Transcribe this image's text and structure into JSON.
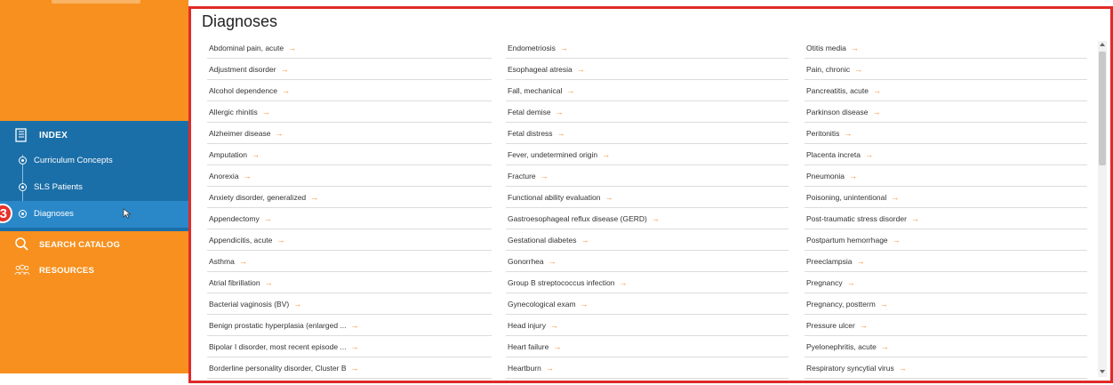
{
  "sidebar": {
    "index_label": "INDEX",
    "index_items": [
      {
        "label": "Curriculum Concepts"
      },
      {
        "label": "SLS Patients"
      },
      {
        "label": "Diagnoses"
      }
    ],
    "step_badge": "3",
    "nav": [
      {
        "label": "SEARCH CATALOG",
        "icon": "search-icon"
      },
      {
        "label": "RESOURCES",
        "icon": "people-icon"
      }
    ]
  },
  "main": {
    "title": "Diagnoses",
    "arrow_glyph": "→",
    "columns": [
      [
        "Abdominal pain, acute",
        "Adjustment disorder",
        "Alcohol dependence",
        "Allergic rhinitis",
        "Alzheimer disease",
        "Amputation",
        "Anorexia",
        "Anxiety disorder, generalized",
        "Appendectomy",
        "Appendicitis, acute",
        "Asthma",
        "Atrial fibrillation",
        "Bacterial vaginosis (BV)",
        "Benign prostatic hyperplasia (enlarged ...",
        "Bipolar I disorder, most recent episode ...",
        "Borderline personality disorder, Cluster B"
      ],
      [
        "Endometriosis",
        "Esophageal atresia",
        "Fall, mechanical",
        "Fetal demise",
        "Fetal distress",
        "Fever, undetermined origin",
        "Fracture",
        "Functional ability evaluation",
        "Gastroesophageal reflux disease (GERD)",
        "Gestational diabetes",
        "Gonorrhea",
        "Group B streptococcus infection",
        "Gynecological exam",
        "Head injury",
        "Heart failure",
        "Heartburn"
      ],
      [
        "Otitis media",
        "Pain, chronic",
        "Pancreatitis, acute",
        "Parkinson disease",
        "Peritonitis",
        "Placenta increta",
        "Pneumonia",
        "Poisoning, unintentional",
        "Post-traumatic stress disorder",
        "Postpartum hemorrhage",
        "Preeclampsia",
        "Pregnancy",
        "Pregnancy, postterm",
        "Pressure ulcer",
        "Pyelonephritis, acute",
        "Respiratory syncytial virus"
      ]
    ]
  },
  "colors": {
    "sidebar_orange": "#f7901e",
    "index_blue": "#1b6fa8",
    "active_blue": "#2a88c8",
    "highlight_red": "#e02b27",
    "arrow_orange": "#f28a2e"
  }
}
